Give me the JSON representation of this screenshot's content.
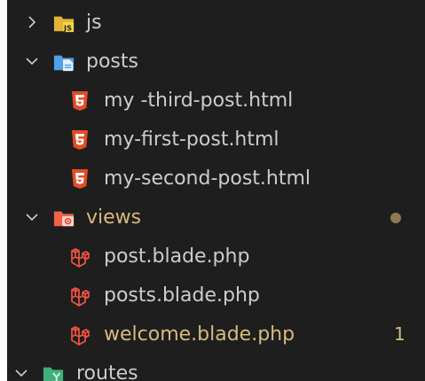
{
  "explorer": {
    "items": [
      {
        "label": "js",
        "kind": "folder",
        "state": "collapsed",
        "icon": "js-folder-icon"
      },
      {
        "label": "posts",
        "kind": "folder",
        "state": "expanded",
        "icon": "posts-folder-icon"
      },
      {
        "label": "my -third-post.html",
        "kind": "file",
        "icon": "html5-icon"
      },
      {
        "label": "my-first-post.html",
        "kind": "file",
        "icon": "html5-icon"
      },
      {
        "label": "my-second-post.html",
        "kind": "file",
        "icon": "html5-icon"
      },
      {
        "label": "views",
        "kind": "folder",
        "state": "expanded",
        "icon": "views-folder-icon",
        "modified": true
      },
      {
        "label": "post.blade.php",
        "kind": "file",
        "icon": "laravel-icon"
      },
      {
        "label": "posts.blade.php",
        "kind": "file",
        "icon": "laravel-icon"
      },
      {
        "label": "welcome.blade.php",
        "kind": "file",
        "icon": "laravel-icon",
        "modified": true,
        "badge": "1"
      },
      {
        "label": "routes",
        "kind": "folder",
        "state": "expanded",
        "icon": "routes-folder-icon"
      }
    ]
  },
  "colors": {
    "background": "#1e1e1e",
    "text": "#cccccc",
    "modified_text": "#d7ba7d",
    "html_icon": "#e44d26",
    "laravel_icon": "#f05340",
    "js_folder": "#e2b53a",
    "posts_folder": "#4fa0e8",
    "views_folder": "#f0624a",
    "routes_folder": "#3fb07a"
  }
}
